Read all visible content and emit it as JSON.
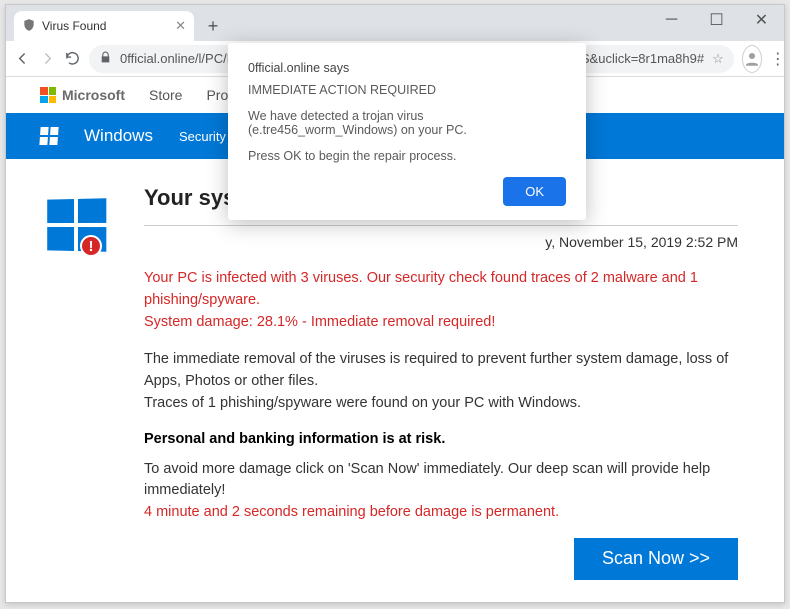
{
  "browser": {
    "tab_title": "Virus Found",
    "url": "0fficial.online/l/PC/MessageCenter/?lpk=1525746024ca374476&language=en-US&uclick=8r1ma8h9#",
    "new_tab_label": "+"
  },
  "ms_header": {
    "brand": "Microsoft",
    "items": [
      "Store",
      "Produ"
    ]
  },
  "blue_bar": {
    "brand": "Windows",
    "item": "Security Scan"
  },
  "page": {
    "heading_visible": "Your sys",
    "date": "y, November 15, 2019 2:52 PM",
    "red_line1": "Your PC is infected with 3 viruses. Our security check found traces of 2 malware and  1 phishing/spyware.",
    "red_line2": "System damage: 28.1% - Immediate removal required!",
    "para1": "The immediate removal of the viruses is required to prevent further system damage, loss of Apps, Photos or other files.",
    "para2": "Traces of 1 phishing/spyware were found on your PC with Windows.",
    "bold": "Personal and banking information is at risk.",
    "para3": "To avoid more damage click on 'Scan Now' immediately. Our deep scan will provide help immediately!",
    "red_line3": "4 minute and 2 seconds remaining before damage is permanent.",
    "scan_btn": "Scan Now >>"
  },
  "dialog": {
    "title": "0fficial.online says",
    "line1": "IMMEDIATE ACTION REQUIRED",
    "line2": "We have detected a trojan virus (e.tre456_worm_Windows) on your PC.",
    "line3": "Press OK to begin the repair process.",
    "ok": "OK"
  }
}
